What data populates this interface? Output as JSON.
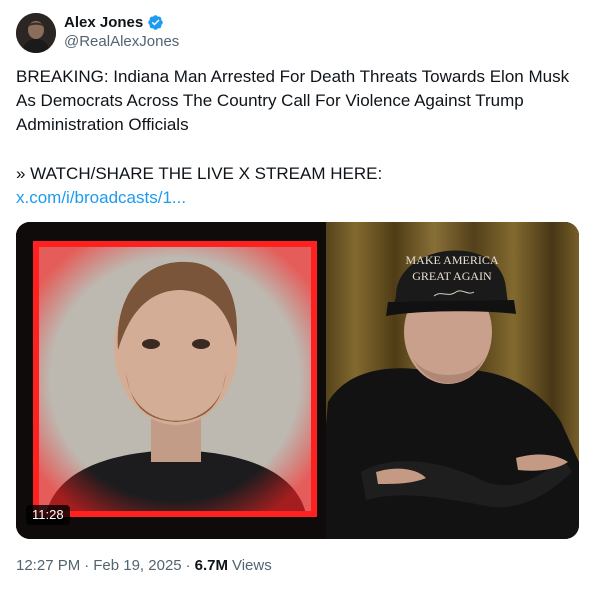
{
  "author": {
    "display_name": "Alex Jones",
    "handle": "@RealAlexJones",
    "verified_icon": "verified-badge-icon",
    "verified_color": "#1d9bf0"
  },
  "tweet": {
    "text": "BREAKING: Indiana Man Arrested For Death Threats Towards Elon Musk As Democrats Across The Country Call For Violence Against Trump Administration Officials",
    "watch_line": "» WATCH/SHARE THE LIVE X STREAM HERE:",
    "link_text": "x.com/i/broadcasts/1..."
  },
  "media": {
    "duration": "11:28",
    "hat_line1": "MAKE AMERICA",
    "hat_line2": "GREAT AGAIN",
    "frame_color": "#ff2020"
  },
  "meta": {
    "time": "12:27 PM",
    "separator": "·",
    "date": "Feb 19, 2025",
    "views_count": "6.7M",
    "views_label": "Views"
  },
  "colors": {
    "text": "#0f1419",
    "secondary": "#536471",
    "link": "#1d9bf0"
  }
}
